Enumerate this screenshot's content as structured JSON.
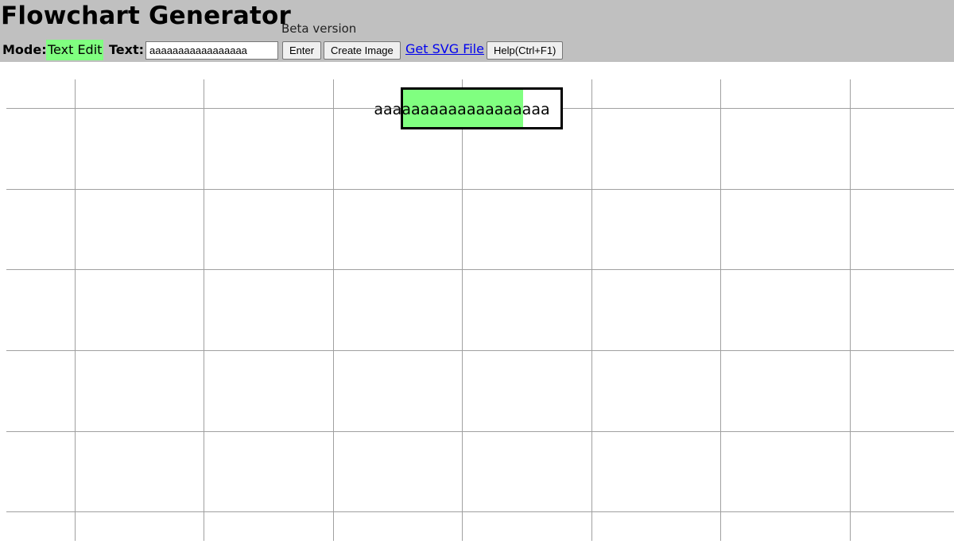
{
  "app": {
    "title": "Flowchart Generator",
    "subtitle": "Beta version"
  },
  "toolbar": {
    "mode_label": "Mode:",
    "mode_value": "Text Edit",
    "text_label": "Text:",
    "text_value": "aaaaaaaaaaaaaaaaa",
    "enter_label": "Enter",
    "create_image_label": "Create Image",
    "get_svg_label": "Get SVG File",
    "help_label": "Help(Ctrl+F1)"
  },
  "colors": {
    "header_bg": "#c0c0c0",
    "mode_highlight": "#80ff80",
    "node_fill": "#80ff80",
    "grid_line": "#a0a0a0",
    "link": "#0000ee"
  },
  "canvas": {
    "node": {
      "text": "aaaaaaaaaaaaaaaaaaa",
      "selected": true
    }
  }
}
